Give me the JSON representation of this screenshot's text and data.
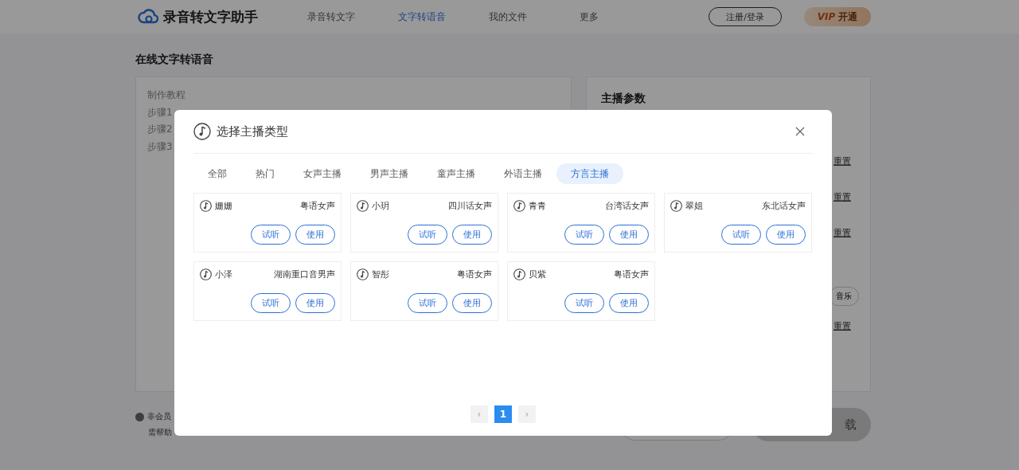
{
  "header": {
    "logo": "录音转文字助手",
    "nav": [
      {
        "label": "录音转文字",
        "selected": false
      },
      {
        "label": "文字转语音",
        "selected": true
      },
      {
        "label": "我的文件",
        "selected": false
      },
      {
        "label": "更多",
        "selected": false
      }
    ],
    "login": "注册/登录",
    "vip": {
      "badge": "VIP",
      "label": "开通"
    }
  },
  "page_title": "在线文字转语音",
  "tutorial": {
    "title": "制作教程",
    "steps": [
      "步骤1",
      "步骤2",
      "步骤3"
    ]
  },
  "params": {
    "title": "主播参数",
    "reset_links": [
      "重置",
      "重置",
      "重置",
      "重置"
    ],
    "music_button": "音乐"
  },
  "notice": [
    "非会员",
    "需帮助"
  ],
  "action_button": "载",
  "dialog": {
    "title": "选择主播类型",
    "tabs": [
      {
        "label": "全部",
        "selected": false
      },
      {
        "label": "热门",
        "selected": false
      },
      {
        "label": "女声主播",
        "selected": false
      },
      {
        "label": "男声主播",
        "selected": false
      },
      {
        "label": "童声主播",
        "selected": false
      },
      {
        "label": "外语主播",
        "selected": false
      },
      {
        "label": "方言主播",
        "selected": true
      }
    ],
    "voices": [
      {
        "name": "姗姗",
        "type": "粤语女声",
        "listen": "试听",
        "use": "使用"
      },
      {
        "name": "小玥",
        "type": "四川话女声",
        "listen": "试听",
        "use": "使用"
      },
      {
        "name": "青青",
        "type": "台湾话女声",
        "listen": "试听",
        "use": "使用"
      },
      {
        "name": "翠姐",
        "type": "东北话女声",
        "listen": "试听",
        "use": "使用"
      },
      {
        "name": "小泽",
        "type": "湖南重口音男声",
        "listen": "试听",
        "use": "使用"
      },
      {
        "name": "智彤",
        "type": "粤语女声",
        "listen": "试听",
        "use": "使用"
      },
      {
        "name": "贝紫",
        "type": "粤语女声",
        "listen": "试听",
        "use": "使用"
      }
    ],
    "pagination": {
      "prev": "‹",
      "pages": [
        {
          "label": "1",
          "selected": true
        }
      ],
      "next": "›"
    }
  }
}
